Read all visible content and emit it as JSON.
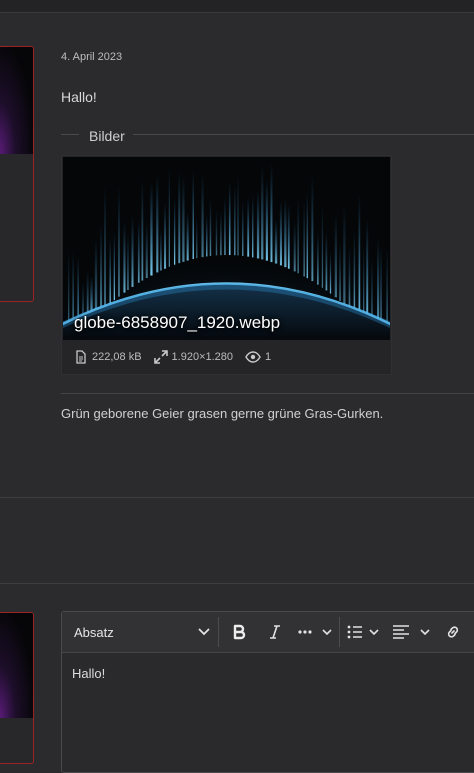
{
  "post": {
    "date": "4. April 2023",
    "greeting": "Hallo!",
    "attachments_legend": "Bilder",
    "attachment": {
      "filename": "globe-6858907_1920.webp",
      "size": "222,08 kB",
      "dimensions": "1.920×1.280",
      "views": "1"
    },
    "signature": "Grün geborene Geier grasen gerne grüne Gras-Gurken."
  },
  "editor": {
    "format_select": "Absatz",
    "content": "Hallo!",
    "toolbar_icons": [
      "bold-icon",
      "italic-icon",
      "more-icon",
      "list-icon",
      "align-icon",
      "link-icon"
    ]
  },
  "colors": {
    "background": "#2b2b2d",
    "avatar_border": "#9b2323",
    "globe_glow": "#4fc3ff"
  }
}
